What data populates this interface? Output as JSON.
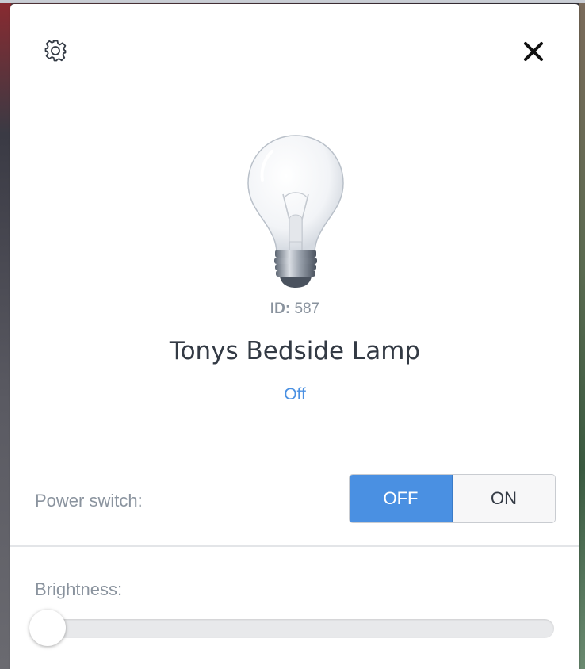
{
  "panel": {
    "icons": {
      "settings": "gear-icon",
      "close": "close-icon"
    }
  },
  "device": {
    "icon": "lightbulb-icon",
    "id_label": "ID:",
    "id_value": "587",
    "name": "Tonys Bedside Lamp",
    "state": "Off"
  },
  "controls": {
    "power_label": "Power switch:",
    "power_off_label": "OFF",
    "power_on_label": "ON",
    "power_selected": "OFF",
    "brightness_label": "Brightness:",
    "brightness_value": 0
  },
  "colors": {
    "accent": "#4a90e2",
    "text_primary": "#333a44",
    "text_muted": "#8a939e"
  }
}
